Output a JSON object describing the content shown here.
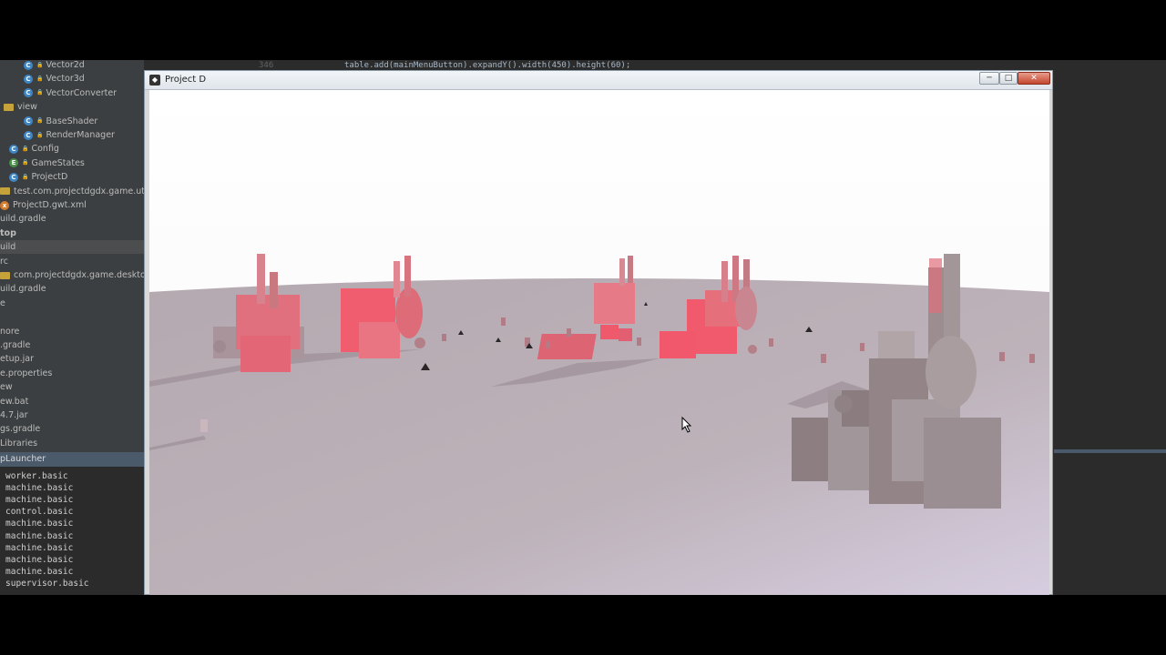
{
  "ide": {
    "code_line_number": "346",
    "code_line": "table.add(mainMenuButton).expandY().width(450).height(60);",
    "project_tree": [
      {
        "icon": "class",
        "label": "Vector2d"
      },
      {
        "icon": "class",
        "label": "Vector3d"
      },
      {
        "icon": "class",
        "label": "VectorConverter"
      },
      {
        "icon": "folder",
        "label": "view"
      },
      {
        "icon": "class",
        "label": "BaseShader"
      },
      {
        "icon": "class",
        "label": "RenderManager"
      },
      {
        "icon": "class",
        "label": "Config"
      },
      {
        "icon": "enum",
        "label": "GameStates"
      },
      {
        "icon": "class",
        "label": "ProjectD"
      },
      {
        "icon": "folder",
        "label": "test.com.projectdgdx.game.utils"
      },
      {
        "icon": "xml",
        "label": "ProjectD.gwt.xml"
      },
      {
        "icon": "none",
        "label": "uild.gradle"
      },
      {
        "icon": "none",
        "label": "top"
      },
      {
        "icon": "none",
        "label": "uild"
      },
      {
        "icon": "none",
        "label": "rc"
      },
      {
        "icon": "folder",
        "label": "com.projectdgdx.game.desktop"
      },
      {
        "icon": "none",
        "label": "uild.gradle"
      },
      {
        "icon": "none",
        "label": "e"
      },
      {
        "icon": "none",
        "label": ""
      },
      {
        "icon": "none",
        "label": "nore"
      },
      {
        "icon": "none",
        "label": ".gradle"
      },
      {
        "icon": "none",
        "label": "etup.jar"
      },
      {
        "icon": "none",
        "label": "e.properties"
      },
      {
        "icon": "none",
        "label": "ew"
      },
      {
        "icon": "none",
        "label": "ew.bat"
      },
      {
        "icon": "none",
        "label": "4.7.jar"
      },
      {
        "icon": "none",
        "label": "gs.gradle"
      },
      {
        "icon": "none",
        "label": "Libraries"
      }
    ],
    "run_header": "pLauncher",
    "console_lines": [
      "worker.basic",
      "machine.basic",
      "machine.basic",
      "control.basic",
      "machine.basic",
      "machine.basic",
      "machine.basic",
      "machine.basic",
      "machine.basic",
      "supervisor.basic"
    ]
  },
  "game_window": {
    "title": "Project D",
    "minimize_label": "─",
    "maximize_label": "□",
    "close_label": "✕",
    "colors": {
      "sky": "#ffffff",
      "ground": "#b9aeb6",
      "machine_red": "#e85a6a",
      "machine_grey": "#a49a9c"
    }
  }
}
